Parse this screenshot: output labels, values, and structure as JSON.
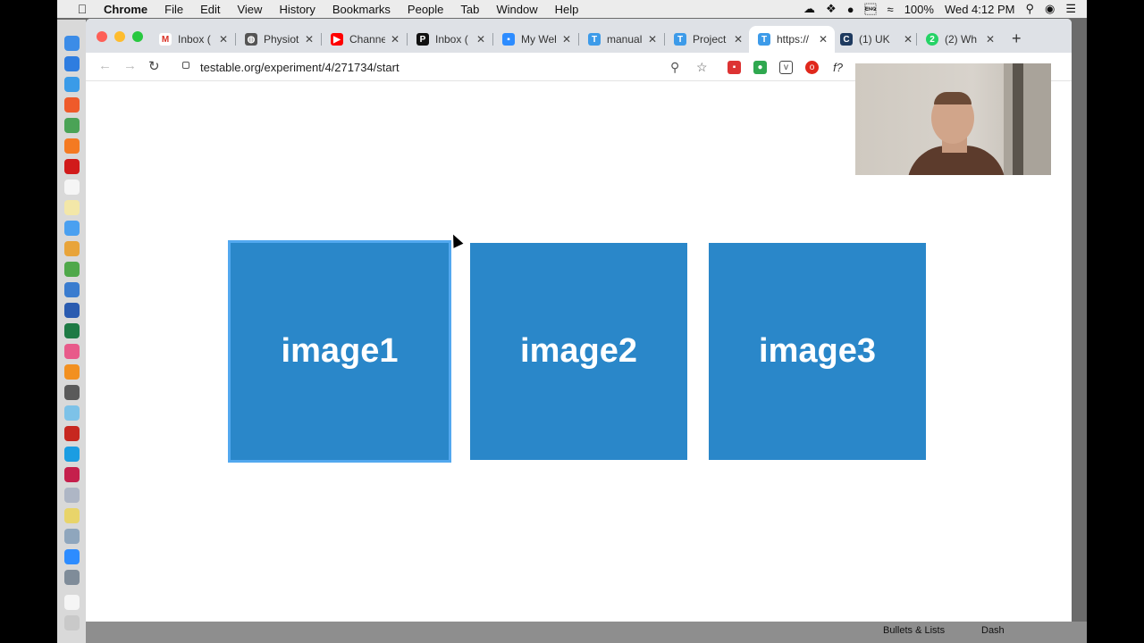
{
  "menubar": {
    "app_name": "Chrome",
    "items": [
      "File",
      "Edit",
      "View",
      "History",
      "Bookmarks",
      "People",
      "Tab",
      "Window",
      "Help"
    ],
    "battery": "100%",
    "clock": "Wed 4:12 PM"
  },
  "tabs": [
    {
      "title": "Inbox (",
      "icon": "gmail-icon",
      "color": "#d93025"
    },
    {
      "title": "Physiot",
      "icon": "globe-icon",
      "color": "#555555"
    },
    {
      "title": "Channe",
      "icon": "youtube-icon",
      "color": "#ff0000"
    },
    {
      "title": "Inbox (",
      "icon": "p-icon",
      "color": "#111111"
    },
    {
      "title": "My Wel",
      "icon": "zoom-icon",
      "color": "#2d8cff"
    },
    {
      "title": "manual",
      "icon": "testable-icon",
      "color": "#3d9be9"
    },
    {
      "title": "Project",
      "icon": "testable-icon",
      "color": "#3d9be9"
    },
    {
      "title": "https://",
      "icon": "testable-icon",
      "color": "#3d9be9"
    },
    {
      "title": "(1) UK",
      "icon": "c-icon",
      "color": "#1e3a5f"
    },
    {
      "title": "(2) Wh",
      "icon": "whatsapp-icon",
      "color": "#25d366"
    }
  ],
  "address_bar": {
    "url": "testable.org/experiment/4/271734/start"
  },
  "stimuli": [
    {
      "label": "image1",
      "selected": true
    },
    {
      "label": "image2",
      "selected": false
    },
    {
      "label": "image3",
      "selected": false
    }
  ],
  "bottom_panel": {
    "label_left": "Bullets & Lists",
    "label_right": "Dash"
  },
  "colors": {
    "tile": "#2a87c9",
    "tile_selected_border": "#52a8ef"
  }
}
